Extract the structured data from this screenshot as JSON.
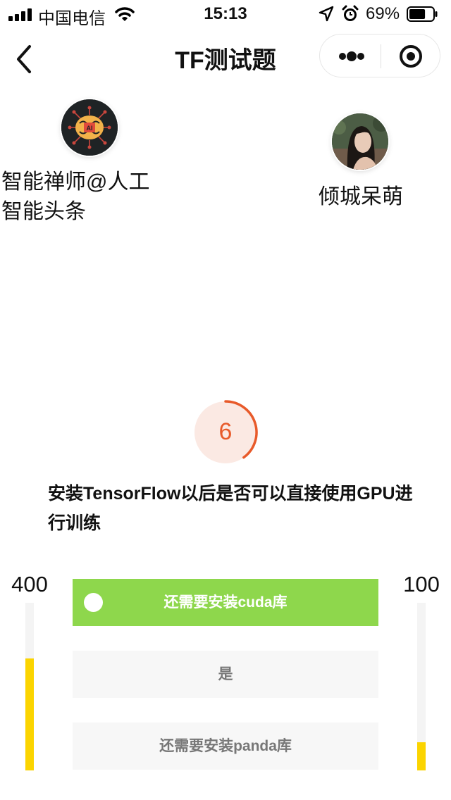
{
  "status_bar": {
    "carrier": "中国电信",
    "time": "15:13",
    "battery_percent": "69%",
    "battery_level": 0.69,
    "icons": [
      "signal-icon",
      "wifi-icon",
      "location-arrow-icon",
      "alarm-icon",
      "battery-icon"
    ]
  },
  "nav": {
    "title": "TF测试题",
    "icons": [
      "back-chevron-icon",
      "more-dots-icon",
      "close-target-icon"
    ]
  },
  "players": {
    "left": {
      "name": "智能禅师@人工智能头条",
      "avatar_icon": "ai-brain-avatar-icon",
      "score": "400",
      "bar_level": 0.67
    },
    "right": {
      "name": "倾城呆萌",
      "avatar_icon": "girl-photo-avatar-icon",
      "score": "100",
      "bar_level": 0.17
    }
  },
  "timer": {
    "seconds": "6",
    "color": "#e85a2a",
    "progress_fraction": 0.4
  },
  "question": {
    "text": "安装TensorFlow以后是否可以直接使用GPU进行训练"
  },
  "options": [
    {
      "label": "还需要安装cuda库",
      "selected": true,
      "color": "#8ed74c"
    },
    {
      "label": "是",
      "selected": false
    },
    {
      "label": "还需要安装panda库",
      "selected": false
    }
  ],
  "colors": {
    "score_bar": "#fbd400",
    "option_bg": "#f7f7f7",
    "selected_option": "#8ed74c"
  }
}
